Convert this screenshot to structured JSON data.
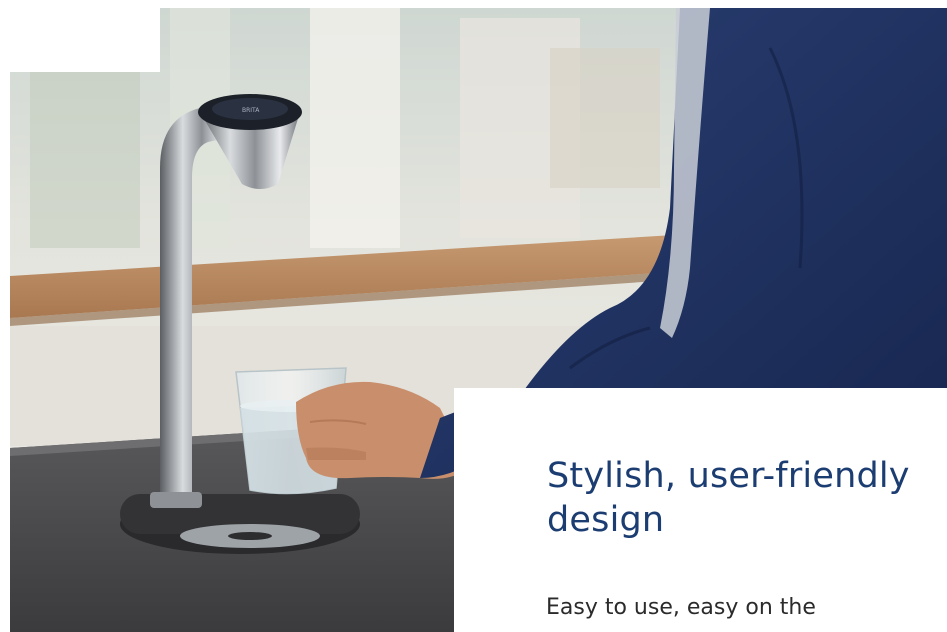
{
  "hero": {
    "image_description": "water-tap-dispensing-into-glass-photo"
  },
  "card": {
    "headline": "Stylish, user-friendly design",
    "body": "Easy to use, easy on the"
  },
  "colors": {
    "headline": "#1c3d72",
    "body_text": "#2b2b2b",
    "background": "#ffffff"
  }
}
